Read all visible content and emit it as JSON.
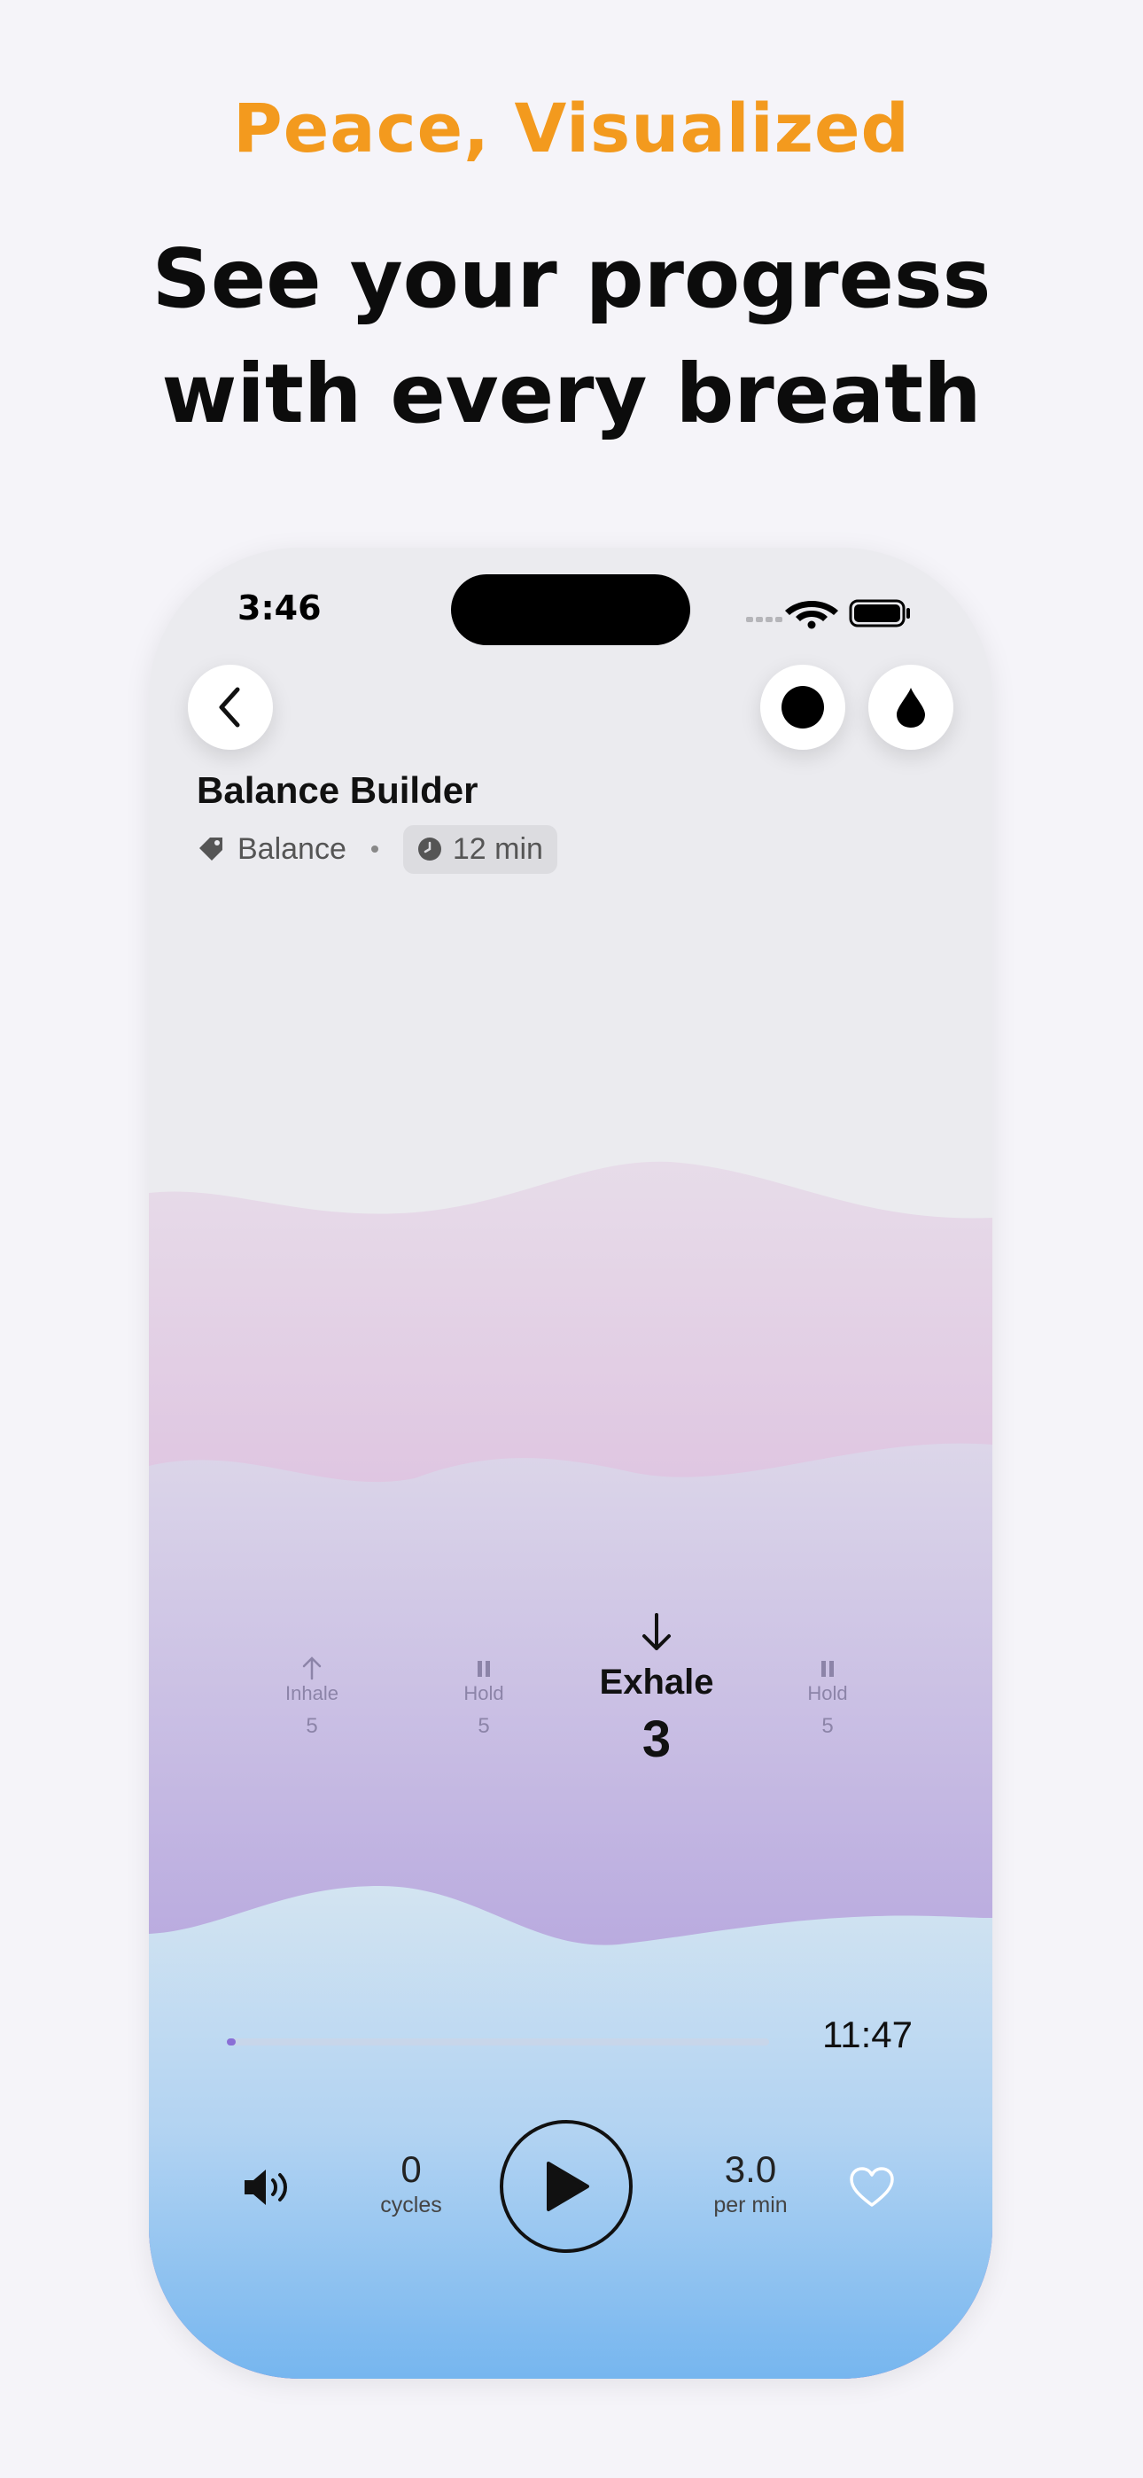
{
  "promo": {
    "eyebrow": "Peace, Visualized",
    "headline_line1": "See your progress",
    "headline_line2": "with every breath"
  },
  "status_bar": {
    "time": "3:46"
  },
  "header": {
    "back_icon": "chevron-left-icon",
    "record_icon": "filled-circle-icon",
    "drop_icon": "water-drop-icon"
  },
  "session": {
    "title": "Balance Builder",
    "category": "Balance",
    "duration": "12 min"
  },
  "phases": [
    {
      "label": "Inhale",
      "count": "5",
      "icon": "arrow-up-icon"
    },
    {
      "label": "Hold",
      "count": "5",
      "icon": "pause-icon"
    },
    {
      "label": "Exhale",
      "count": "3",
      "icon": "arrow-down-icon",
      "active": true
    },
    {
      "label": "Hold",
      "count": "5",
      "icon": "pause-icon"
    }
  ],
  "playback": {
    "progress_fraction": 0.01,
    "time_remaining": "11:47",
    "cycles_value": "0",
    "cycles_label": "cycles",
    "rate_value": "3.0",
    "rate_label": "per min"
  },
  "colors": {
    "accent": "#f39a1e",
    "wave_pink": "#c587d1",
    "wave_purple": "#9c84cf",
    "wave_blue": "#7ab9ef",
    "progress": "#8a6fd6"
  }
}
